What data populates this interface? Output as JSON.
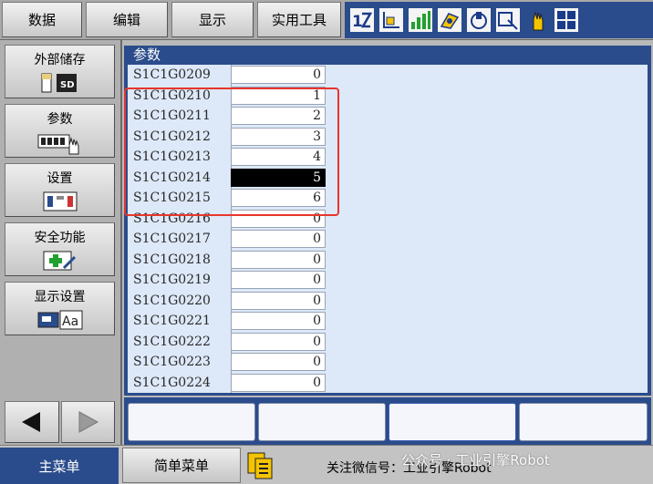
{
  "menubar": {
    "items": [
      {
        "label": "数据"
      },
      {
        "label": "编辑"
      },
      {
        "label": "显示"
      },
      {
        "label": "实用工具"
      }
    ]
  },
  "toolbar_icons": [
    "robot-axis-icon",
    "coordinate-frame-icon",
    "speed-bars-icon",
    "tool-icon",
    "home-icon",
    "step-icon",
    "hand-icon",
    "grid-icon"
  ],
  "sidebar": {
    "items": [
      {
        "label": "外部储存",
        "icon": "sd-card-icon"
      },
      {
        "label": "参数",
        "icon": "keypad-hand-icon"
      },
      {
        "label": "设置",
        "icon": "settings-panel-icon"
      },
      {
        "label": "安全功能",
        "icon": "safety-plus-icon"
      },
      {
        "label": "显示设置",
        "icon": "display-font-icon"
      }
    ]
  },
  "panel": {
    "title": "参数",
    "rows": [
      {
        "name": "S1C1G0209",
        "value": "0"
      },
      {
        "name": "S1C1G0210",
        "value": "1"
      },
      {
        "name": "S1C1G0211",
        "value": "2"
      },
      {
        "name": "S1C1G0212",
        "value": "3"
      },
      {
        "name": "S1C1G0213",
        "value": "4"
      },
      {
        "name": "S1C1G0214",
        "value": "5"
      },
      {
        "name": "S1C1G0215",
        "value": "6"
      },
      {
        "name": "S1C1G0216",
        "value": "0"
      },
      {
        "name": "S1C1G0217",
        "value": "0"
      },
      {
        "name": "S1C1G0218",
        "value": "0"
      },
      {
        "name": "S1C1G0219",
        "value": "0"
      },
      {
        "name": "S1C1G0220",
        "value": "0"
      },
      {
        "name": "S1C1G0221",
        "value": "0"
      },
      {
        "name": "S1C1G0222",
        "value": "0"
      },
      {
        "name": "S1C1G0223",
        "value": "0"
      },
      {
        "name": "S1C1G0224",
        "value": "0"
      }
    ]
  },
  "bottombar": {
    "main_menu": "主菜单",
    "simple_menu": "简单菜单",
    "status": "关注微信号：工业引擎Robot",
    "watermark": "公众号 · 工业引擎Robot"
  },
  "colors": {
    "accent": "#2b4c8c",
    "grid_bg": "#dde8f8",
    "highlight": "#e8362b"
  }
}
